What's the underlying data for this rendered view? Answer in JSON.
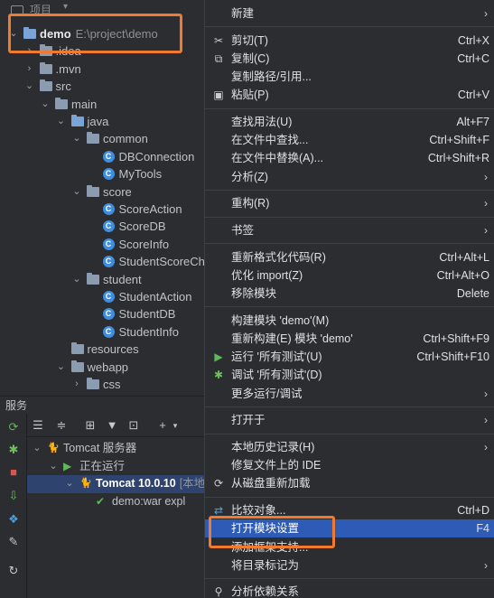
{
  "project": {
    "header_title": "项目",
    "tree": [
      {
        "label": "demo",
        "path": "E:\\project\\demo",
        "type": "root",
        "depth": 0,
        "expanded": true
      },
      {
        "label": ".idea",
        "type": "folder",
        "depth": 1,
        "expanded": false
      },
      {
        "label": ".mvn",
        "type": "folder",
        "depth": 1,
        "expanded": false
      },
      {
        "label": "src",
        "type": "folder",
        "depth": 1,
        "expanded": true
      },
      {
        "label": "main",
        "type": "folder",
        "depth": 2,
        "expanded": true
      },
      {
        "label": "java",
        "type": "source",
        "depth": 3,
        "expanded": true
      },
      {
        "label": "common",
        "type": "package",
        "depth": 4,
        "expanded": true
      },
      {
        "label": "DBConnection",
        "type": "class",
        "depth": 5
      },
      {
        "label": "MyTools",
        "type": "class",
        "depth": 5
      },
      {
        "label": "score",
        "type": "package",
        "depth": 4,
        "expanded": true
      },
      {
        "label": "ScoreAction",
        "type": "class",
        "depth": 5
      },
      {
        "label": "ScoreDB",
        "type": "class",
        "depth": 5
      },
      {
        "label": "ScoreInfo",
        "type": "class",
        "depth": 5
      },
      {
        "label": "StudentScoreCh",
        "type": "class",
        "depth": 5
      },
      {
        "label": "student",
        "type": "package",
        "depth": 4,
        "expanded": true
      },
      {
        "label": "StudentAction",
        "type": "class",
        "depth": 5
      },
      {
        "label": "StudentDB",
        "type": "class",
        "depth": 5
      },
      {
        "label": "StudentInfo",
        "type": "class",
        "depth": 5
      },
      {
        "label": "resources",
        "type": "resources",
        "depth": 3
      },
      {
        "label": "webapp",
        "type": "folder",
        "depth": 3,
        "expanded": true
      },
      {
        "label": "css",
        "type": "folder",
        "depth": 4,
        "expanded": false
      }
    ]
  },
  "services": {
    "title": "服务",
    "tree": [
      {
        "label": "Tomcat 服务器",
        "depth": 0,
        "icon": "tomcat",
        "expanded": true
      },
      {
        "label": "正在运行",
        "depth": 1,
        "icon": "run",
        "expanded": true
      },
      {
        "label": "Tomcat 10.0.10",
        "suffix": "[本地",
        "depth": 2,
        "icon": "tomcat",
        "expanded": true,
        "selected": true
      },
      {
        "label": "demo:war expl",
        "depth": 3,
        "icon": "artifact"
      }
    ]
  },
  "menu": {
    "items": [
      {
        "label": "新建",
        "shortcut": "",
        "submenu": true,
        "icon": ""
      },
      {
        "sep": true
      },
      {
        "label": "剪切(T)",
        "shortcut": "Ctrl+X",
        "icon": "scissors"
      },
      {
        "label": "复制(C)",
        "shortcut": "Ctrl+C",
        "icon": "copy"
      },
      {
        "label": "复制路径/引用...",
        "shortcut": "",
        "icon": ""
      },
      {
        "label": "粘贴(P)",
        "shortcut": "Ctrl+V",
        "icon": "paste"
      },
      {
        "sep": true
      },
      {
        "label": "查找用法(U)",
        "shortcut": "Alt+F7",
        "icon": ""
      },
      {
        "label": "在文件中查找...",
        "shortcut": "Ctrl+Shift+F",
        "icon": ""
      },
      {
        "label": "在文件中替换(A)...",
        "shortcut": "Ctrl+Shift+R",
        "icon": ""
      },
      {
        "label": "分析(Z)",
        "shortcut": "",
        "submenu": true,
        "icon": ""
      },
      {
        "sep": true
      },
      {
        "label": "重构(R)",
        "shortcut": "",
        "submenu": true,
        "icon": ""
      },
      {
        "sep": true
      },
      {
        "label": "书签",
        "shortcut": "",
        "submenu": true,
        "icon": ""
      },
      {
        "sep": true
      },
      {
        "label": "重新格式化代码(R)",
        "shortcut": "Ctrl+Alt+L",
        "icon": ""
      },
      {
        "label": "优化 import(Z)",
        "shortcut": "Ctrl+Alt+O",
        "icon": ""
      },
      {
        "label": "移除模块",
        "shortcut": "Delete",
        "icon": ""
      },
      {
        "sep": true
      },
      {
        "label": "构建模块 'demo'(M)",
        "shortcut": "",
        "icon": ""
      },
      {
        "label": "重新构建(E) 模块 'demo'",
        "shortcut": "Ctrl+Shift+F9",
        "icon": ""
      },
      {
        "label": "运行 '所有测试'(U)",
        "shortcut": "Ctrl+Shift+F10",
        "icon": "run"
      },
      {
        "label": "调试 '所有测试'(D)",
        "shortcut": "",
        "icon": "debug"
      },
      {
        "label": "更多运行/调试",
        "shortcut": "",
        "submenu": true,
        "icon": ""
      },
      {
        "sep": true
      },
      {
        "label": "打开于",
        "shortcut": "",
        "submenu": true,
        "icon": ""
      },
      {
        "sep": true
      },
      {
        "label": "本地历史记录(H)",
        "shortcut": "",
        "submenu": true,
        "icon": ""
      },
      {
        "label": "修复文件上的 IDE",
        "shortcut": "",
        "icon": ""
      },
      {
        "label": "从磁盘重新加载",
        "shortcut": "",
        "icon": "reload"
      },
      {
        "sep": true
      },
      {
        "label": "比较对象...",
        "shortcut": "Ctrl+D",
        "icon": "compare"
      },
      {
        "label": "打开模块设置",
        "shortcut": "F4",
        "icon": "",
        "highlighted": true
      },
      {
        "label": "添加框架支持...",
        "shortcut": "",
        "icon": ""
      },
      {
        "label": "将目录标记为",
        "shortcut": "",
        "submenu": true,
        "icon": ""
      },
      {
        "sep": true
      },
      {
        "label": "分析依赖关系",
        "shortcut": "",
        "icon": "dependency"
      }
    ]
  },
  "colors": {
    "background": "#2b2d30",
    "menu_highlight": "#2e5bb5",
    "selection": "#2e436e",
    "callout": "#f07a30",
    "class_icon": "#3e8ee0"
  }
}
